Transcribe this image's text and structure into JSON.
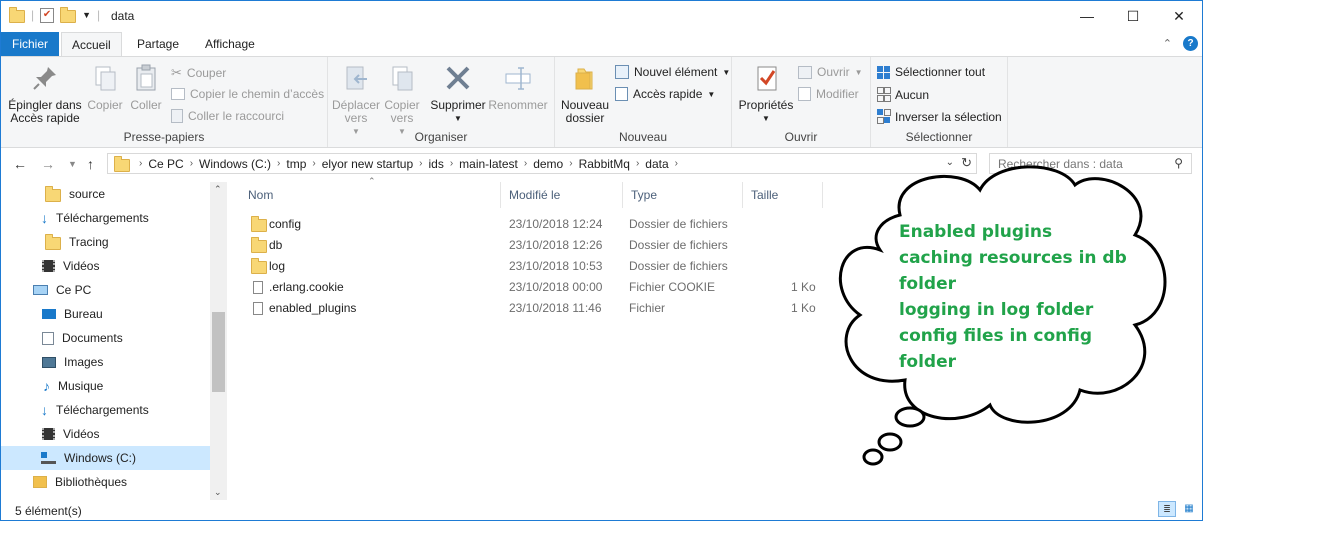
{
  "window": {
    "title": "data",
    "controls": {
      "minimize": "—",
      "maximize": "☐",
      "close": "✕"
    }
  },
  "ribbon_tabs": [
    "Fichier",
    "Accueil",
    "Partage",
    "Affichage"
  ],
  "ribbon": {
    "clipboard": {
      "pin": "Épingler dans Accès rapide",
      "copy": "Copier",
      "paste": "Coller",
      "cut": "Couper",
      "copy_path": "Copier le chemin d’accès",
      "paste_shortcut": "Coller le raccourci",
      "label": "Presse-papiers"
    },
    "organize": {
      "move": "Déplacer vers",
      "copy_to": "Copier vers",
      "delete": "Supprimer",
      "rename": "Renommer",
      "label": "Organiser"
    },
    "new": {
      "folder": "Nouveau dossier",
      "new_item": "Nouvel élément",
      "easy_access": "Accès rapide",
      "label": "Nouveau"
    },
    "open": {
      "properties": "Propriétés",
      "open": "Ouvrir",
      "modify": "Modifier",
      "label": "Ouvrir"
    },
    "select": {
      "all": "Sélectionner tout",
      "none": "Aucun",
      "invert": "Inverser la sélection",
      "label": "Sélectionner"
    }
  },
  "breadcrumb": [
    "Ce PC",
    "Windows (C:)",
    "tmp",
    "elyor new startup",
    "ids",
    "main-latest",
    "demo",
    "RabbitMq",
    "data"
  ],
  "search": {
    "placeholder": "Rechercher dans : data"
  },
  "nav": {
    "items": [
      {
        "label": "source",
        "icon": "folder-icon"
      },
      {
        "label": "Téléchargements",
        "icon": "download-icon"
      },
      {
        "label": "Tracing",
        "icon": "folder-icon"
      },
      {
        "label": "Vidéos",
        "icon": "video-icon"
      },
      {
        "label": "Ce PC",
        "icon": "computer-icon"
      },
      {
        "label": "Bureau",
        "icon": "desktop-icon"
      },
      {
        "label": "Documents",
        "icon": "documents-icon"
      },
      {
        "label": "Images",
        "icon": "images-icon"
      },
      {
        "label": "Musique",
        "icon": "music-icon"
      },
      {
        "label": "Téléchargements",
        "icon": "download-icon"
      },
      {
        "label": "Vidéos",
        "icon": "video-icon"
      },
      {
        "label": "Windows (C:)",
        "icon": "drive-icon"
      },
      {
        "label": "Bibliothèques",
        "icon": "library-icon"
      }
    ]
  },
  "columns": [
    "Nom",
    "Modifié le",
    "Type",
    "Taille"
  ],
  "files": [
    {
      "name": "config",
      "modified": "23/10/2018 12:24",
      "type": "Dossier de fichiers",
      "size": ""
    },
    {
      "name": "db",
      "modified": "23/10/2018 12:26",
      "type": "Dossier de fichiers",
      "size": ""
    },
    {
      "name": "log",
      "modified": "23/10/2018 10:53",
      "type": "Dossier de fichiers",
      "size": ""
    },
    {
      "name": ".erlang.cookie",
      "modified": "23/10/2018 00:00",
      "type": "Fichier COOKIE",
      "size": "1 Ko"
    },
    {
      "name": "enabled_plugins",
      "modified": "23/10/2018 11:46",
      "type": "Fichier",
      "size": "1 Ko"
    }
  ],
  "status": "5 élément(s)",
  "annotation": {
    "lines": [
      "Enabled plugins",
      "caching resources in db",
      "folder",
      "logging in log folder",
      "config files in config",
      "folder"
    ],
    "color": "#21a34a"
  }
}
